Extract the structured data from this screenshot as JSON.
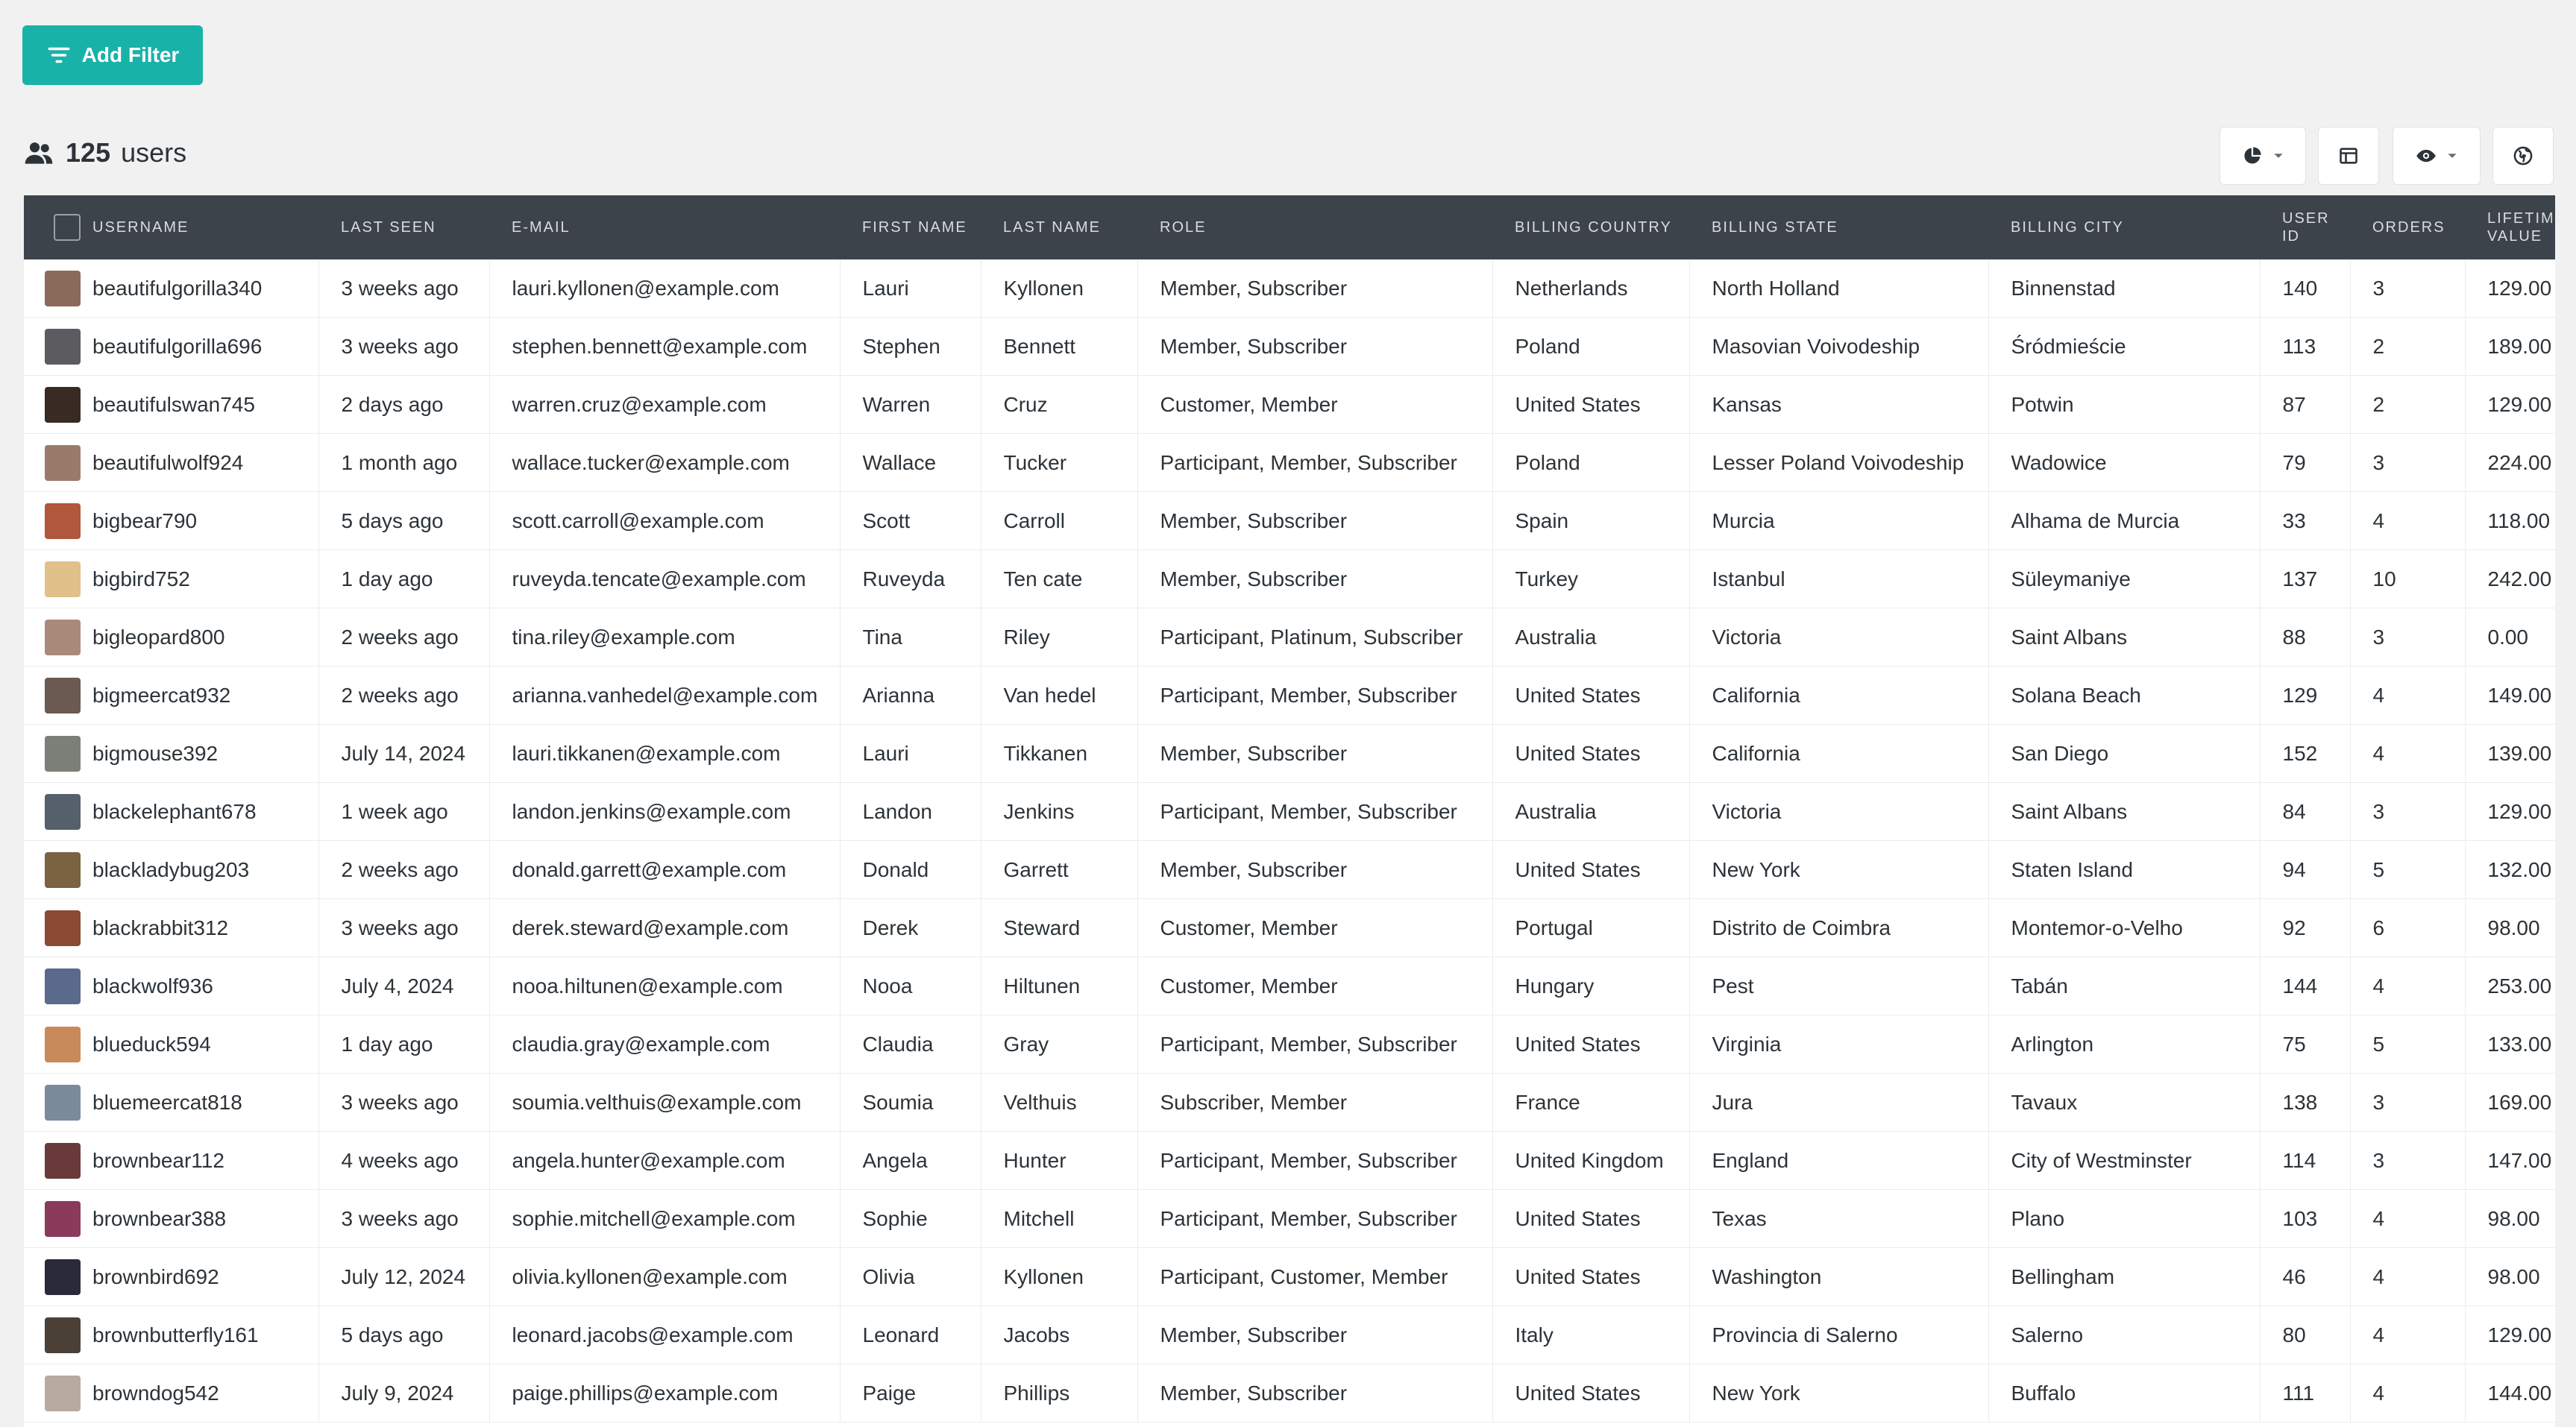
{
  "toolbar": {
    "add_filter_label": "Add Filter",
    "users_count": "125",
    "users_label": "users",
    "buttons": [
      {
        "name": "chart-view-button",
        "icon": "pie-chart-icon",
        "dropdown": true
      },
      {
        "name": "layout-button",
        "icon": "layout-icon",
        "dropdown": false
      },
      {
        "name": "visibility-button",
        "icon": "eye-icon",
        "dropdown": true
      },
      {
        "name": "globe-button",
        "icon": "globe-icon",
        "dropdown": false
      }
    ]
  },
  "colors": {
    "accent": "#19b2a9",
    "header_bg": "#3c434a",
    "header_text": "#dcdcde",
    "page_bg": "#f1f1f1"
  },
  "table": {
    "columns": [
      {
        "key": "username",
        "label": "USERNAME"
      },
      {
        "key": "last_seen",
        "label": "LAST SEEN"
      },
      {
        "key": "email",
        "label": "E-MAIL"
      },
      {
        "key": "first_name",
        "label": "FIRST NAME"
      },
      {
        "key": "last_name",
        "label": "LAST NAME"
      },
      {
        "key": "role",
        "label": "ROLE"
      },
      {
        "key": "country",
        "label": "BILLING COUNTRY"
      },
      {
        "key": "state",
        "label": "BILLING STATE"
      },
      {
        "key": "city",
        "label": "BILLING CITY"
      },
      {
        "key": "user_id",
        "label": "USER ID"
      },
      {
        "key": "orders",
        "label": "ORDERS"
      },
      {
        "key": "ltv",
        "label": "LIFETIME VALUE"
      }
    ],
    "rows": [
      {
        "avatar": "#8a6a5a",
        "username": "beautifulgorilla340",
        "last_seen": "3 weeks ago",
        "email": "lauri.kyllonen@example.com",
        "first_name": "Lauri",
        "last_name": "Kyllonen",
        "role": "Member, Subscriber",
        "country": "Netherlands",
        "state": "North Holland",
        "city": "Binnenstad",
        "user_id": "140",
        "orders": "3",
        "ltv": "129.00"
      },
      {
        "avatar": "#5b5b60",
        "username": "beautifulgorilla696",
        "last_seen": "3 weeks ago",
        "email": "stephen.bennett@example.com",
        "first_name": "Stephen",
        "last_name": "Bennett",
        "role": "Member, Subscriber",
        "country": "Poland",
        "state": "Masovian Voivodeship",
        "city": "Śródmieście",
        "user_id": "113",
        "orders": "2",
        "ltv": "189.00"
      },
      {
        "avatar": "#3a2a24",
        "username": "beautifulswan745",
        "last_seen": "2 days ago",
        "email": "warren.cruz@example.com",
        "first_name": "Warren",
        "last_name": "Cruz",
        "role": "Customer, Member",
        "country": "United States",
        "state": "Kansas",
        "city": "Potwin",
        "user_id": "87",
        "orders": "2",
        "ltv": "129.00"
      },
      {
        "avatar": "#9a7b6a",
        "username": "beautifulwolf924",
        "last_seen": "1 month ago",
        "email": "wallace.tucker@example.com",
        "first_name": "Wallace",
        "last_name": "Tucker",
        "role": "Participant, Member, Subscriber",
        "country": "Poland",
        "state": "Lesser Poland Voivodeship",
        "city": "Wadowice",
        "user_id": "79",
        "orders": "3",
        "ltv": "224.00"
      },
      {
        "avatar": "#b0573c",
        "username": "bigbear790",
        "last_seen": "5 days ago",
        "email": "scott.carroll@example.com",
        "first_name": "Scott",
        "last_name": "Carroll",
        "role": "Member, Subscriber",
        "country": "Spain",
        "state": "Murcia",
        "city": "Alhama de Murcia",
        "user_id": "33",
        "orders": "4",
        "ltv": "118.00"
      },
      {
        "avatar": "#e2c08a",
        "username": "bigbird752",
        "last_seen": "1 day ago",
        "email": "ruveyda.tencate@example.com",
        "first_name": "Ruveyda",
        "last_name": "Ten cate",
        "role": "Member, Subscriber",
        "country": "Turkey",
        "state": "Istanbul",
        "city": "Süleymaniye",
        "user_id": "137",
        "orders": "10",
        "ltv": "242.00"
      },
      {
        "avatar": "#a98a7a",
        "username": "bigleopard800",
        "last_seen": "2 weeks ago",
        "email": "tina.riley@example.com",
        "first_name": "Tina",
        "last_name": "Riley",
        "role": "Participant, Platinum, Subscriber",
        "country": "Australia",
        "state": "Victoria",
        "city": "Saint Albans",
        "user_id": "88",
        "orders": "3",
        "ltv": "0.00"
      },
      {
        "avatar": "#6a5a52",
        "username": "bigmeercat932",
        "last_seen": "2 weeks ago",
        "email": "arianna.vanhedel@example.com",
        "first_name": "Arianna",
        "last_name": "Van hedel",
        "role": "Participant, Member, Subscriber",
        "country": "United States",
        "state": "California",
        "city": "Solana Beach",
        "user_id": "129",
        "orders": "4",
        "ltv": "149.00"
      },
      {
        "avatar": "#7a7f78",
        "username": "bigmouse392",
        "last_seen": "July 14, 2024",
        "email": "lauri.tikkanen@example.com",
        "first_name": "Lauri",
        "last_name": "Tikkanen",
        "role": "Member, Subscriber",
        "country": "United States",
        "state": "California",
        "city": "San Diego",
        "user_id": "152",
        "orders": "4",
        "ltv": "139.00"
      },
      {
        "avatar": "#56606a",
        "username": "blackelephant678",
        "last_seen": "1 week ago",
        "email": "landon.jenkins@example.com",
        "first_name": "Landon",
        "last_name": "Jenkins",
        "role": "Participant, Member, Subscriber",
        "country": "Australia",
        "state": "Victoria",
        "city": "Saint Albans",
        "user_id": "84",
        "orders": "3",
        "ltv": "129.00"
      },
      {
        "avatar": "#7b6240",
        "username": "blackladybug203",
        "last_seen": "2 weeks ago",
        "email": "donald.garrett@example.com",
        "first_name": "Donald",
        "last_name": "Garrett",
        "role": "Member, Subscriber",
        "country": "United States",
        "state": "New York",
        "city": "Staten Island",
        "user_id": "94",
        "orders": "5",
        "ltv": "132.00"
      },
      {
        "avatar": "#8a4a34",
        "username": "blackrabbit312",
        "last_seen": "3 weeks ago",
        "email": "derek.steward@example.com",
        "first_name": "Derek",
        "last_name": "Steward",
        "role": "Customer, Member",
        "country": "Portugal",
        "state": "Distrito de Coimbra",
        "city": "Montemor-o-Velho",
        "user_id": "92",
        "orders": "6",
        "ltv": "98.00"
      },
      {
        "avatar": "#5a6a8a",
        "username": "blackwolf936",
        "last_seen": "July 4, 2024",
        "email": "nooa.hiltunen@example.com",
        "first_name": "Nooa",
        "last_name": "Hiltunen",
        "role": "Customer, Member",
        "country": "Hungary",
        "state": "Pest",
        "city": "Tabán",
        "user_id": "144",
        "orders": "4",
        "ltv": "253.00"
      },
      {
        "avatar": "#c98a5a",
        "username": "blueduck594",
        "last_seen": "1 day ago",
        "email": "claudia.gray@example.com",
        "first_name": "Claudia",
        "last_name": "Gray",
        "role": "Participant, Member, Subscriber",
        "country": "United States",
        "state": "Virginia",
        "city": "Arlington",
        "user_id": "75",
        "orders": "5",
        "ltv": "133.00"
      },
      {
        "avatar": "#7a8a9a",
        "username": "bluemeercat818",
        "last_seen": "3 weeks ago",
        "email": "soumia.velthuis@example.com",
        "first_name": "Soumia",
        "last_name": "Velthuis",
        "role": "Subscriber, Member",
        "country": "France",
        "state": "Jura",
        "city": "Tavaux",
        "user_id": "138",
        "orders": "3",
        "ltv": "169.00"
      },
      {
        "avatar": "#6a3a3a",
        "username": "brownbear112",
        "last_seen": "4 weeks ago",
        "email": "angela.hunter@example.com",
        "first_name": "Angela",
        "last_name": "Hunter",
        "role": "Participant, Member, Subscriber",
        "country": "United Kingdom",
        "state": "England",
        "city": "City of Westminster",
        "user_id": "114",
        "orders": "3",
        "ltv": "147.00"
      },
      {
        "avatar": "#8a3a5a",
        "username": "brownbear388",
        "last_seen": "3 weeks ago",
        "email": "sophie.mitchell@example.com",
        "first_name": "Sophie",
        "last_name": "Mitchell",
        "role": "Participant, Member, Subscriber",
        "country": "United States",
        "state": "Texas",
        "city": "Plano",
        "user_id": "103",
        "orders": "4",
        "ltv": "98.00"
      },
      {
        "avatar": "#2a2a3a",
        "username": "brownbird692",
        "last_seen": "July 12, 2024",
        "email": "olivia.kyllonen@example.com",
        "first_name": "Olivia",
        "last_name": "Kyllonen",
        "role": "Participant, Customer, Member",
        "country": "United States",
        "state": "Washington",
        "city": "Bellingham",
        "user_id": "46",
        "orders": "4",
        "ltv": "98.00"
      },
      {
        "avatar": "#4a4038",
        "username": "brownbutterfly161",
        "last_seen": "5 days ago",
        "email": "leonard.jacobs@example.com",
        "first_name": "Leonard",
        "last_name": "Jacobs",
        "role": "Member, Subscriber",
        "country": "Italy",
        "state": "Provincia di Salerno",
        "city": "Salerno",
        "user_id": "80",
        "orders": "4",
        "ltv": "129.00"
      },
      {
        "avatar": "#b8aaa0",
        "username": "browndog542",
        "last_seen": "July 9, 2024",
        "email": "paige.phillips@example.com",
        "first_name": "Paige",
        "last_name": "Phillips",
        "role": "Member, Subscriber",
        "country": "United States",
        "state": "New York",
        "city": "Buffalo",
        "user_id": "111",
        "orders": "4",
        "ltv": "144.00"
      }
    ]
  }
}
